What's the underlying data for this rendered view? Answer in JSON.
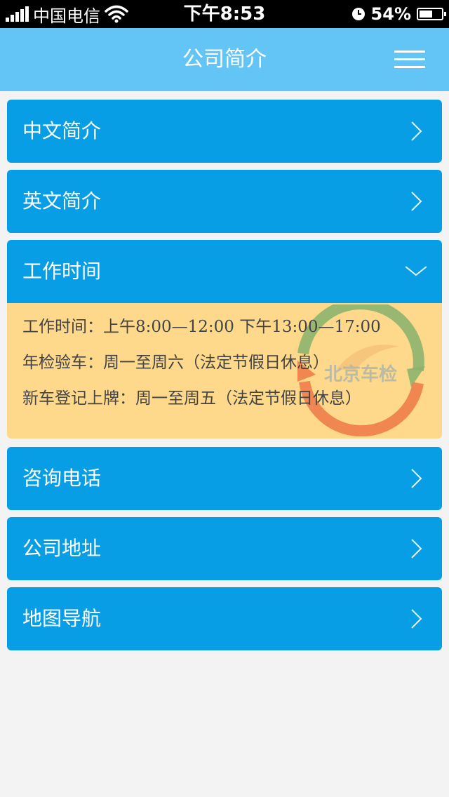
{
  "status_bar": {
    "carrier": "中国电信",
    "time": "下午8:53",
    "battery": "54%",
    "battery_level": 0.54
  },
  "header": {
    "title": "公司简介",
    "menu_icon": "hamburger-icon"
  },
  "sections": [
    {
      "label": "中文简介",
      "icon": "chevron-right-icon",
      "expanded": false
    },
    {
      "label": "英文简介",
      "icon": "chevron-right-icon",
      "expanded": false
    },
    {
      "label": "工作时间",
      "icon": "chevron-down-icon",
      "expanded": true
    },
    {
      "label": "咨询电话",
      "icon": "chevron-right-icon",
      "expanded": false
    },
    {
      "label": "公司地址",
      "icon": "chevron-right-icon",
      "expanded": false
    },
    {
      "label": "地图导航",
      "icon": "chevron-right-icon",
      "expanded": false
    }
  ],
  "work_time_panel": {
    "lines": [
      "工作时间：上午8:00—12:00 下午13:00—17:00",
      "年检验车：周一至周六（法定节假日休息）",
      "新车登记上牌：周一至周五（法定节假日休息）"
    ],
    "logo_text": "北京车检"
  },
  "colors": {
    "header_bg": "#62c5f6",
    "item_bg": "#079ee5",
    "panel_bg": "#fed98b",
    "page_bg": "#f3f3f3"
  }
}
